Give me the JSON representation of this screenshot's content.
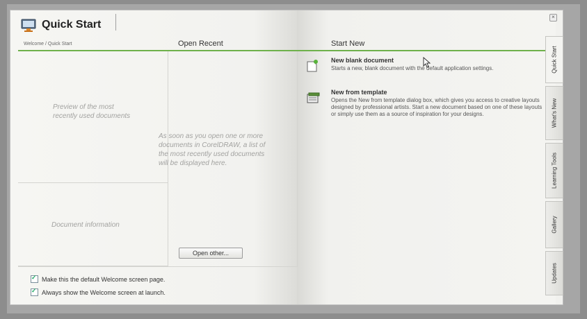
{
  "app": {
    "title": "Quick Start"
  },
  "breadcrumb": "Welcome / Quick Start",
  "columns": {
    "open_recent": "Open Recent",
    "start_new": "Start New"
  },
  "left": {
    "preview_text": "Preview of the most recently used documents",
    "doc_info_text": "Document information"
  },
  "recent": {
    "empty_text": "As soon as you open one or more documents in CorelDRAW, a list of the most recently used documents will be displayed here.",
    "open_other_label": "Open other..."
  },
  "start_new": {
    "items": [
      {
        "title": "New blank document",
        "desc": "Starts a new, blank document with the default application settings.",
        "icon": "new-document-icon"
      },
      {
        "title": "New from template",
        "desc": "Opens the New from template dialog box, which gives you access to creative layouts designed by professional artists. Start a new document based on one of these layouts or simply use them as a source of inspiration for your designs.",
        "icon": "template-icon"
      }
    ]
  },
  "checkboxes": [
    {
      "label": "Make this the default Welcome screen page.",
      "checked": true
    },
    {
      "label": "Always show the Welcome screen at launch.",
      "checked": true
    }
  ],
  "side_tabs": [
    "Quick Start",
    "What's New",
    "Learning Tools",
    "Gallery",
    "Updates"
  ],
  "colors": {
    "accent": "#6eb14b",
    "background": "#8d8d8d"
  }
}
